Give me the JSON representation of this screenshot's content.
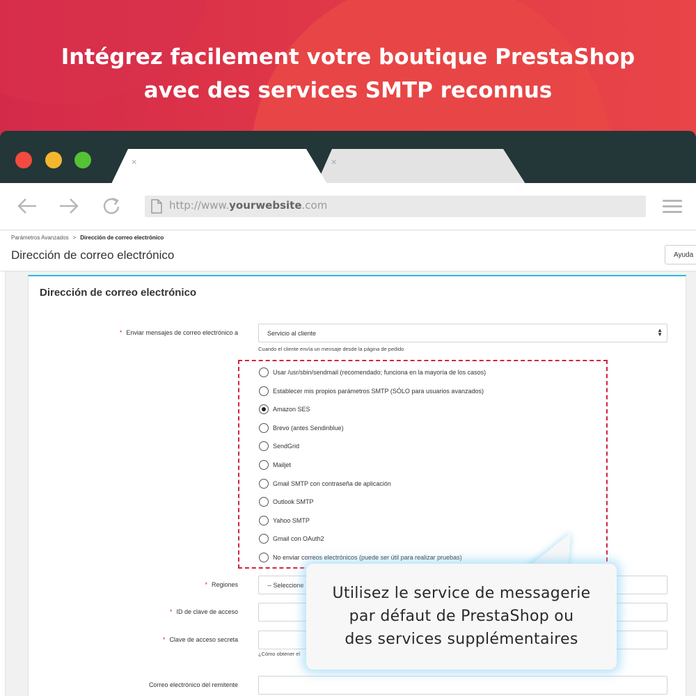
{
  "hero": {
    "line1": "Intégrez facilement votre boutique PrestaShop",
    "line2": "avec des services SMTP reconnus"
  },
  "browser": {
    "url_prefix": "http://www.",
    "url_domain": "yourwebsite",
    "url_suffix": ".com",
    "tab_close": "×"
  },
  "admin": {
    "breadcrumb_parent": "Parámetros Avanzados",
    "breadcrumb_sep": ">",
    "breadcrumb_current": "Dirección de correo electrónico",
    "page_title": "Dirección de correo electrónico",
    "help_button": "Ayuda",
    "panel_title": "Dirección de correo electrónico",
    "send_to_label": "Enviar mensajes de correo electrónico a",
    "send_to_value": "Servicio al cliente",
    "send_to_help": "Cuando el cliente envía un mensaje desde la página de pedido",
    "options": [
      {
        "label": "Usar /usr/sbin/sendmail (recomendado; funciona en la mayoría de los casos)",
        "checked": false
      },
      {
        "label": "Establecer mis propios parámetros SMTP (SÓLO para usuarios avanzados)",
        "checked": false
      },
      {
        "label": "Amazon SES",
        "checked": true
      },
      {
        "label": "Brevo (antes Sendinblue)",
        "checked": false
      },
      {
        "label": "SendGrid",
        "checked": false
      },
      {
        "label": "Mailjet",
        "checked": false
      },
      {
        "label": "Gmail SMTP con contraseña de aplicación",
        "checked": false
      },
      {
        "label": "Outlook SMTP",
        "checked": false
      },
      {
        "label": "Yahoo SMTP",
        "checked": false
      },
      {
        "label": "Gmail con OAuth2",
        "checked": false
      },
      {
        "label": "No enviar correos electrónicos (puede ser útil para realizar pruebas)",
        "checked": false
      }
    ],
    "regions_label": "Regiones",
    "regions_value": "-- Seleccione",
    "access_key_label": "ID de clave de acceso",
    "secret_key_label": "Clave de acceso secreta",
    "secret_key_help": "¿Cómo obtener el",
    "sender_email_label": "Correo electrónico del remitente"
  },
  "callout": {
    "line1": "Utilisez le service de messagerie",
    "line2": "par défaut de PrestaShop ou",
    "line3": "des services supplémentaires"
  },
  "colors": {
    "hero_red": "#e23a47",
    "chrome_dark": "#233638",
    "accent_blue": "#25b9d7",
    "highlight_red": "#d2233c"
  }
}
